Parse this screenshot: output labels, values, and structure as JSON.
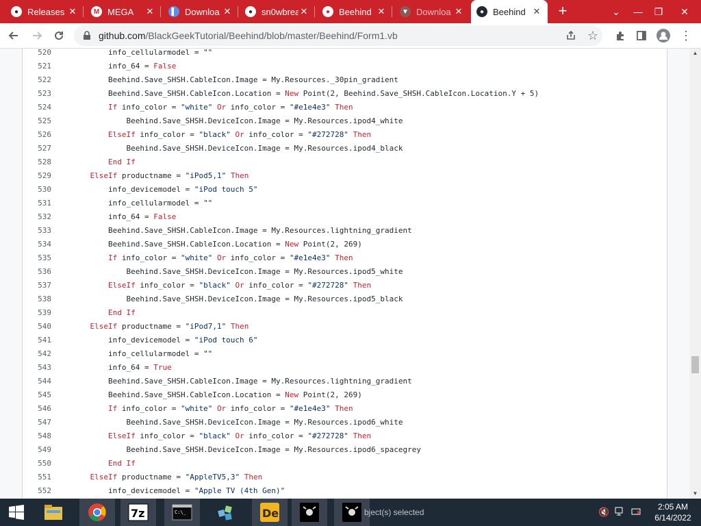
{
  "browser": {
    "tabs": [
      {
        "label": "Releases",
        "icon": "github-icon"
      },
      {
        "label": "MEGA",
        "icon": "mega-icon"
      },
      {
        "label": "Downloa",
        "icon": "download-icon"
      },
      {
        "label": "sn0wbrea",
        "icon": "github-icon"
      },
      {
        "label": "Beehind",
        "icon": "beehind-icon"
      },
      {
        "label": "Downloa",
        "icon": "download-icon"
      },
      {
        "label": "Beehind",
        "icon": "github-icon"
      }
    ],
    "new_tab": "+",
    "url_domain": "github.com",
    "url_path": "/BlackGeekTutorial/Beehind/blob/master/Beehind/Form1.vb"
  },
  "code": {
    "lines": [
      {
        "n": "520",
        "indent": 2,
        "parts": [
          [
            "p",
            "info_cellularmodel = "
          ],
          [
            "s",
            "\"\""
          ]
        ]
      },
      {
        "n": "521",
        "indent": 2,
        "parts": [
          [
            "p",
            "info_64 = "
          ],
          [
            "k",
            "False"
          ]
        ]
      },
      {
        "n": "522",
        "indent": 2,
        "parts": [
          [
            "p",
            "Beehind.Save_SHSH.CableIcon.Image = My.Resources._30pin_gradient"
          ]
        ]
      },
      {
        "n": "523",
        "indent": 2,
        "parts": [
          [
            "p",
            "Beehind.Save_SHSH.CableIcon.Location = "
          ],
          [
            "k",
            "New"
          ],
          [
            "p",
            " Point(2, Beehind.Save_SHSH.CableIcon.Location.Y + 5)"
          ]
        ]
      },
      {
        "n": "524",
        "indent": 2,
        "parts": [
          [
            "k",
            "If"
          ],
          [
            "p",
            " info_color = "
          ],
          [
            "s",
            "\"white\""
          ],
          [
            "p",
            " "
          ],
          [
            "k",
            "Or"
          ],
          [
            "p",
            " info_color = "
          ],
          [
            "s",
            "\"#e1e4e3\""
          ],
          [
            "p",
            " "
          ],
          [
            "k",
            "Then"
          ]
        ]
      },
      {
        "n": "525",
        "indent": 3,
        "parts": [
          [
            "p",
            "Beehind.Save_SHSH.DeviceIcon.Image = My.Resources.ipod4_white"
          ]
        ]
      },
      {
        "n": "526",
        "indent": 2,
        "parts": [
          [
            "k",
            "ElseIf"
          ],
          [
            "p",
            " info_color = "
          ],
          [
            "s",
            "\"black\""
          ],
          [
            "p",
            " "
          ],
          [
            "k",
            "Or"
          ],
          [
            "p",
            " info_color = "
          ],
          [
            "s",
            "\"#272728\""
          ],
          [
            "p",
            " "
          ],
          [
            "k",
            "Then"
          ]
        ]
      },
      {
        "n": "527",
        "indent": 3,
        "parts": [
          [
            "p",
            "Beehind.Save_SHSH.DeviceIcon.Image = My.Resources.ipod4_black"
          ]
        ]
      },
      {
        "n": "528",
        "indent": 2,
        "parts": [
          [
            "k",
            "End If"
          ]
        ]
      },
      {
        "n": "529",
        "indent": 1,
        "parts": [
          [
            "k",
            "ElseIf"
          ],
          [
            "p",
            " productname = "
          ],
          [
            "s",
            "\"iPod5,1\""
          ],
          [
            "p",
            " "
          ],
          [
            "k",
            "Then"
          ]
        ]
      },
      {
        "n": "530",
        "indent": 2,
        "parts": [
          [
            "p",
            "info_devicemodel = "
          ],
          [
            "s",
            "\"iPod touch 5\""
          ]
        ]
      },
      {
        "n": "531",
        "indent": 2,
        "parts": [
          [
            "p",
            "info_cellularmodel = "
          ],
          [
            "s",
            "\"\""
          ]
        ]
      },
      {
        "n": "532",
        "indent": 2,
        "parts": [
          [
            "p",
            "info_64 = "
          ],
          [
            "k",
            "False"
          ]
        ]
      },
      {
        "n": "533",
        "indent": 2,
        "parts": [
          [
            "p",
            "Beehind.Save_SHSH.CableIcon.Image = My.Resources.lightning_gradient"
          ]
        ]
      },
      {
        "n": "534",
        "indent": 2,
        "parts": [
          [
            "p",
            "Beehind.Save_SHSH.CableIcon.Location = "
          ],
          [
            "k",
            "New"
          ],
          [
            "p",
            " Point(2, 269)"
          ]
        ]
      },
      {
        "n": "535",
        "indent": 2,
        "parts": [
          [
            "k",
            "If"
          ],
          [
            "p",
            " info_color = "
          ],
          [
            "s",
            "\"white\""
          ],
          [
            "p",
            " "
          ],
          [
            "k",
            "Or"
          ],
          [
            "p",
            " info_color = "
          ],
          [
            "s",
            "\"#e1e4e3\""
          ],
          [
            "p",
            " "
          ],
          [
            "k",
            "Then"
          ]
        ]
      },
      {
        "n": "536",
        "indent": 3,
        "parts": [
          [
            "p",
            "Beehind.Save_SHSH.DeviceIcon.Image = My.Resources.ipod5_white"
          ]
        ]
      },
      {
        "n": "537",
        "indent": 2,
        "parts": [
          [
            "k",
            "ElseIf"
          ],
          [
            "p",
            " info_color = "
          ],
          [
            "s",
            "\"black\""
          ],
          [
            "p",
            " "
          ],
          [
            "k",
            "Or"
          ],
          [
            "p",
            " info_color = "
          ],
          [
            "s",
            "\"#272728\""
          ],
          [
            "p",
            " "
          ],
          [
            "k",
            "Then"
          ]
        ]
      },
      {
        "n": "538",
        "indent": 3,
        "parts": [
          [
            "p",
            "Beehind.Save_SHSH.DeviceIcon.Image = My.Resources.ipod5_black"
          ]
        ]
      },
      {
        "n": "539",
        "indent": 2,
        "parts": [
          [
            "k",
            "End If"
          ]
        ]
      },
      {
        "n": "540",
        "indent": 1,
        "parts": [
          [
            "k",
            "ElseIf"
          ],
          [
            "p",
            " productname = "
          ],
          [
            "s",
            "\"iPod7,1\""
          ],
          [
            "p",
            " "
          ],
          [
            "k",
            "Then"
          ]
        ]
      },
      {
        "n": "541",
        "indent": 2,
        "parts": [
          [
            "p",
            "info_devicemodel = "
          ],
          [
            "s",
            "\"iPod touch 6\""
          ]
        ]
      },
      {
        "n": "542",
        "indent": 2,
        "parts": [
          [
            "p",
            "info_cellularmodel = "
          ],
          [
            "s",
            "\"\""
          ]
        ]
      },
      {
        "n": "543",
        "indent": 2,
        "parts": [
          [
            "p",
            "info_64 = "
          ],
          [
            "k",
            "True"
          ]
        ]
      },
      {
        "n": "544",
        "indent": 2,
        "parts": [
          [
            "p",
            "Beehind.Save_SHSH.CableIcon.Image = My.Resources.lightning_gradient"
          ]
        ]
      },
      {
        "n": "545",
        "indent": 2,
        "parts": [
          [
            "p",
            "Beehind.Save_SHSH.CableIcon.Location = "
          ],
          [
            "k",
            "New"
          ],
          [
            "p",
            " Point(2, 269)"
          ]
        ]
      },
      {
        "n": "546",
        "indent": 2,
        "parts": [
          [
            "k",
            "If"
          ],
          [
            "p",
            " info_color = "
          ],
          [
            "s",
            "\"white\""
          ],
          [
            "p",
            " "
          ],
          [
            "k",
            "Or"
          ],
          [
            "p",
            " info_color = "
          ],
          [
            "s",
            "\"#e1e4e3\""
          ],
          [
            "p",
            " "
          ],
          [
            "k",
            "Then"
          ]
        ]
      },
      {
        "n": "547",
        "indent": 3,
        "parts": [
          [
            "p",
            "Beehind.Save_SHSH.DeviceIcon.Image = My.Resources.ipod6_white"
          ]
        ]
      },
      {
        "n": "548",
        "indent": 2,
        "parts": [
          [
            "k",
            "ElseIf"
          ],
          [
            "p",
            " info_color = "
          ],
          [
            "s",
            "\"black\""
          ],
          [
            "p",
            " "
          ],
          [
            "k",
            "Or"
          ],
          [
            "p",
            " info_color = "
          ],
          [
            "s",
            "\"#272728\""
          ],
          [
            "p",
            " "
          ],
          [
            "k",
            "Then"
          ]
        ]
      },
      {
        "n": "549",
        "indent": 3,
        "parts": [
          [
            "p",
            "Beehind.Save_SHSH.DeviceIcon.Image = My.Resources.ipod6_spacegrey"
          ]
        ]
      },
      {
        "n": "550",
        "indent": 2,
        "parts": [
          [
            "k",
            "End If"
          ]
        ]
      },
      {
        "n": "551",
        "indent": 1,
        "parts": [
          [
            "k",
            "ElseIf"
          ],
          [
            "p",
            " productname = "
          ],
          [
            "s",
            "\"AppleTV5,3\""
          ],
          [
            "p",
            " "
          ],
          [
            "k",
            "Then"
          ]
        ]
      },
      {
        "n": "552",
        "indent": 2,
        "parts": [
          [
            "p",
            "info_devicemodel = "
          ],
          [
            "s",
            "\"Apple TV (4th Gen)\""
          ]
        ]
      }
    ]
  },
  "scrollbar": {
    "position_fraction": 0.72,
    "visible_fraction": 0.04
  },
  "taskbar": {
    "status_text": "bject(s) selected",
    "clock_time": "2:05 AM",
    "clock_date": "6/14/2022",
    "apps": [
      "start-icon",
      "file-explorer-icon",
      "chrome-icon",
      "7zip-icon",
      "cmd-icon",
      "app-cubes-icon",
      "de-app-icon",
      "beehind-app-icon",
      "beehind-app-icon"
    ]
  },
  "colors": {
    "chrome_tab_bar": "#cc2229",
    "keyword": "#cf222e",
    "string": "#0a3069"
  }
}
